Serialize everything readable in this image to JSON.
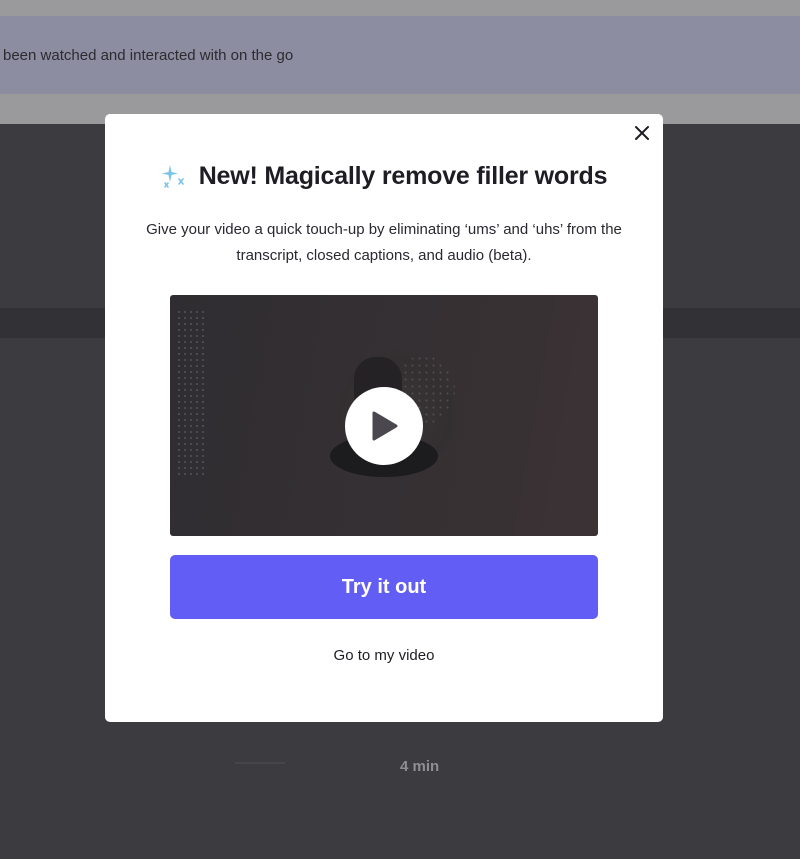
{
  "background": {
    "banner_text": "been watched and interacted with on the go",
    "duration_text": "4 min"
  },
  "modal": {
    "title": "New! Magically remove filler words",
    "title_icon": "sparkle-icon",
    "description": "Give your video a quick touch-up by eliminating ‘ums’ and ‘uhs’ from the transcript, closed captions, and audio (beta).",
    "close_icon": "close-icon",
    "video_play_icon": "play-icon",
    "primary_button_label": "Try it out",
    "secondary_link_label": "Go to my video"
  },
  "colors": {
    "accent": "#625df5",
    "sparkle": "#7cc3e8",
    "overlay_dark": "#3c3b40"
  }
}
